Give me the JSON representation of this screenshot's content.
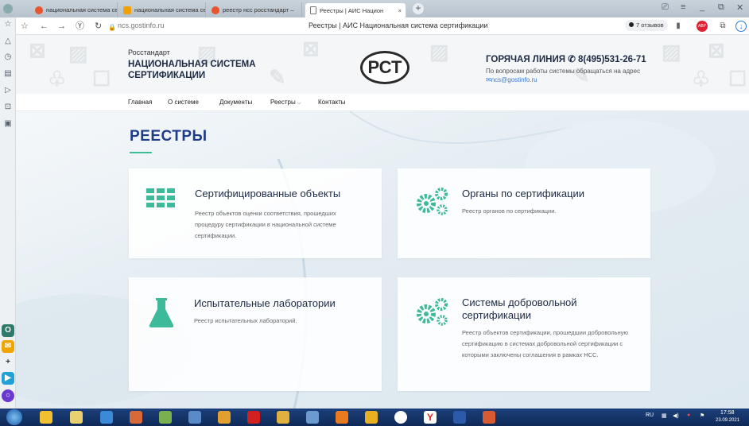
{
  "browser": {
    "tabs": [
      {
        "label": "национальная система се",
        "icon_color": "#e8542c",
        "active": false
      },
      {
        "label": "национальная система се",
        "icon_color": "#f1a20b",
        "active": false
      },
      {
        "label": "реестр нсс росстандарт –",
        "icon_color": "#e8542c",
        "active": false
      },
      {
        "label": "Реестры | АИС Национ",
        "icon_color": "#777777",
        "active": true,
        "close": "×"
      }
    ],
    "new_tab": "+",
    "url": "ncs.gostinfo.ru",
    "page_title": "Реестры | АИС Национальная система сертификации",
    "reviews": "7 отзывов"
  },
  "site": {
    "brand_sub": "Росстандарт",
    "brand_title": "НАЦИОНАЛЬНАЯ СИСТЕМА СЕРТИФИКАЦИИ",
    "logo_text": "РСТ",
    "hotline_label": "ГОРЯЧАЯ ЛИНИЯ",
    "hotline_phone": "8(495)531-26-71",
    "hotline_note": "По вопросам работы системы обращаться на адрес",
    "email": "ncs@gostinfo.ru",
    "menu": [
      "Главная",
      "О системе",
      "Документы",
      "Реестры",
      "Контакты"
    ],
    "heading": "РЕЕСТРЫ",
    "accent_color": "#3dba9a",
    "heading_color": "#1f3c8a",
    "cards": [
      {
        "title": "Сертифицированные объекты",
        "desc": "Реестр объектов оценки соответствия, прошедших процедуру сертификации в национальной системе сертификации.",
        "icon": "grid-icon"
      },
      {
        "title": "Органы по сертификации",
        "desc": "Реестр органов по сертификации.",
        "icon": "gears-icon"
      },
      {
        "title": "Испытательные лаборатории",
        "desc": "Реестр испытательных лабораторий.",
        "icon": "flask-icon"
      },
      {
        "title": "Системы добровольной сертификации",
        "desc": "Реестр объектов сертификации, прошедшии добровольную сертификацию в системах добровольной сертификации с которыми заключены соглашения в рамках НСС.",
        "icon": "gears-icon"
      }
    ]
  },
  "taskbar": {
    "lang": "RU",
    "time": "17:58",
    "date": "23.09.2021"
  }
}
